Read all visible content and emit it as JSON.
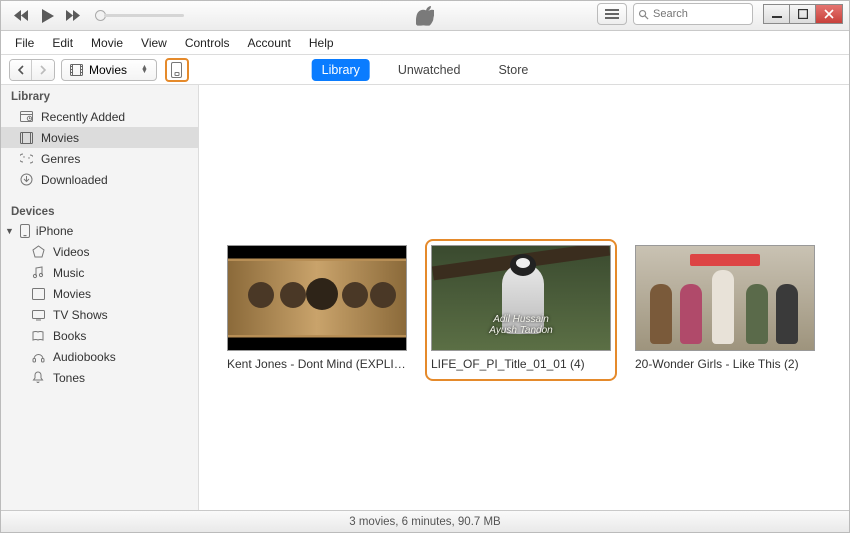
{
  "search": {
    "placeholder": "Search"
  },
  "menubar": [
    "File",
    "Edit",
    "Movie",
    "View",
    "Controls",
    "Account",
    "Help"
  ],
  "toolbar": {
    "media_picker_label": "Movies"
  },
  "center_tabs": {
    "library": "Library",
    "unwatched": "Unwatched",
    "store": "Store"
  },
  "sidebar": {
    "section_library": "Library",
    "library_items": [
      {
        "id": "recently-added",
        "label": "Recently Added"
      },
      {
        "id": "movies",
        "label": "Movies"
      },
      {
        "id": "genres",
        "label": "Genres"
      },
      {
        "id": "downloaded",
        "label": "Downloaded"
      }
    ],
    "section_devices": "Devices",
    "device_name": "iPhone",
    "device_items": [
      {
        "id": "videos",
        "label": "Videos"
      },
      {
        "id": "music",
        "label": "Music"
      },
      {
        "id": "movies",
        "label": "Movies"
      },
      {
        "id": "tvshows",
        "label": "TV Shows"
      },
      {
        "id": "books",
        "label": "Books"
      },
      {
        "id": "audiobooks",
        "label": "Audiobooks"
      },
      {
        "id": "tones",
        "label": "Tones"
      }
    ]
  },
  "movies": [
    {
      "title": "Kent Jones - Dont Mind (EXPLICIT)..."
    },
    {
      "title": "LIFE_OF_PI_Title_01_01 (4)",
      "overlay_line1": "Adil Hussain",
      "overlay_line2": "Ayush Tandon"
    },
    {
      "title": "20-Wonder Girls - Like This (2)"
    }
  ],
  "status_text": "3 movies, 6 minutes, 90.7 MB"
}
